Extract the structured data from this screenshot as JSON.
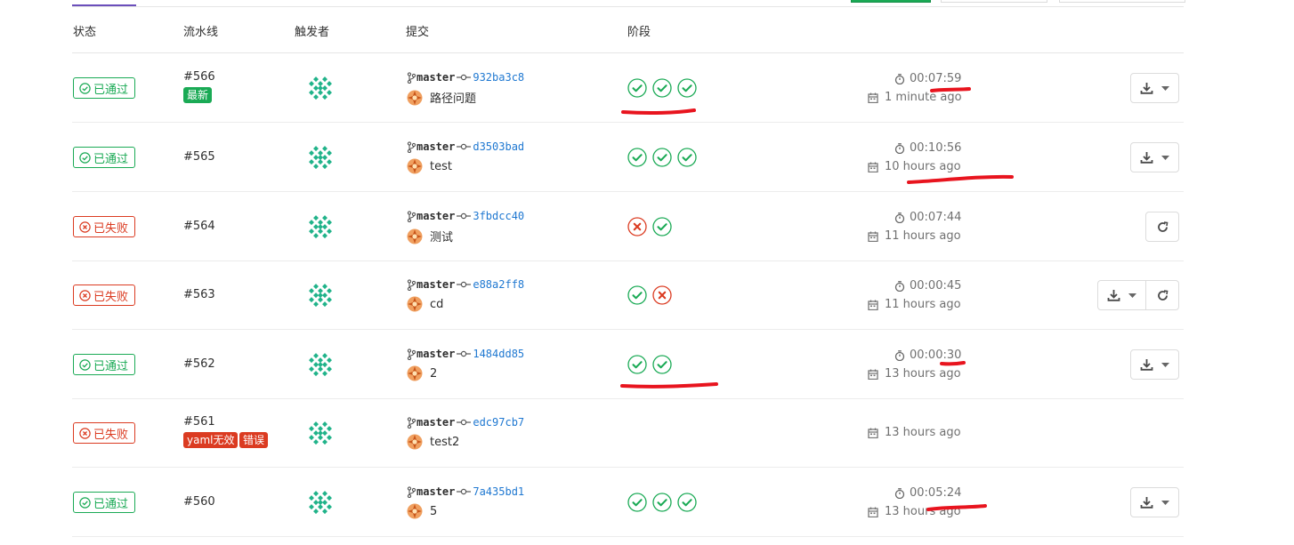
{
  "columns": {
    "status": "状态",
    "pipeline": "流水线",
    "triggerer": "触发者",
    "commit": "提交",
    "stages": "阶段"
  },
  "colors": {
    "passed": "#1aaa55",
    "failed": "#db3b21",
    "sha": "#1f78d1",
    "annotation": "#e8141e"
  },
  "rows": [
    {
      "status": "passed",
      "status_label": "已通过",
      "pipeline_id": "#566",
      "tags": [
        {
          "label": "最新",
          "color": "green"
        }
      ],
      "branch": "master",
      "sha": "932ba3c8",
      "message": "路径问题",
      "stages": [
        "passed",
        "passed",
        "passed"
      ],
      "duration": "00:07:59",
      "finished": "1 minute ago",
      "actions": [
        "download"
      ]
    },
    {
      "status": "passed",
      "status_label": "已通过",
      "pipeline_id": "#565",
      "tags": [],
      "branch": "master",
      "sha": "d3503bad",
      "message": "test",
      "stages": [
        "passed",
        "passed",
        "passed"
      ],
      "duration": "00:10:56",
      "finished": "10 hours ago",
      "actions": [
        "download"
      ]
    },
    {
      "status": "failed",
      "status_label": "已失败",
      "pipeline_id": "#564",
      "tags": [],
      "branch": "master",
      "sha": "3fbdcc40",
      "message": "测试",
      "stages": [
        "failed",
        "passed"
      ],
      "duration": "00:07:44",
      "finished": "11 hours ago",
      "actions": [
        "retry"
      ]
    },
    {
      "status": "failed",
      "status_label": "已失败",
      "pipeline_id": "#563",
      "tags": [],
      "branch": "master",
      "sha": "e88a2ff8",
      "message": "cd",
      "stages": [
        "passed",
        "failed"
      ],
      "duration": "00:00:45",
      "finished": "11 hours ago",
      "actions": [
        "download",
        "retry"
      ]
    },
    {
      "status": "passed",
      "status_label": "已通过",
      "pipeline_id": "#562",
      "tags": [],
      "branch": "master",
      "sha": "1484dd85",
      "message": "2",
      "stages": [
        "passed",
        "passed"
      ],
      "duration": "00:00:30",
      "finished": "13 hours ago",
      "actions": [
        "download"
      ]
    },
    {
      "status": "failed",
      "status_label": "已失败",
      "pipeline_id": "#561",
      "tags": [
        {
          "label": "yaml无效",
          "color": "red"
        },
        {
          "label": "错误",
          "color": "red"
        }
      ],
      "branch": "master",
      "sha": "edc97cb7",
      "message": "test2",
      "stages": [],
      "duration": "",
      "finished": "13 hours ago",
      "actions": []
    },
    {
      "status": "passed",
      "status_label": "已通过",
      "pipeline_id": "#560",
      "tags": [],
      "branch": "master",
      "sha": "7a435bd1",
      "message": "5",
      "stages": [
        "passed",
        "passed",
        "passed"
      ],
      "duration": "00:05:24",
      "finished": "13 hours ago",
      "actions": [
        "download"
      ]
    }
  ],
  "icons": {
    "status_passed": "check-circle-icon",
    "status_failed": "x-circle-icon",
    "branch": "branch-icon",
    "commit": "commit-icon",
    "duration": "timer-icon",
    "finished": "calendar-icon",
    "download": "download-icon",
    "dropdown": "caret-down-icon",
    "retry": "retry-icon"
  }
}
